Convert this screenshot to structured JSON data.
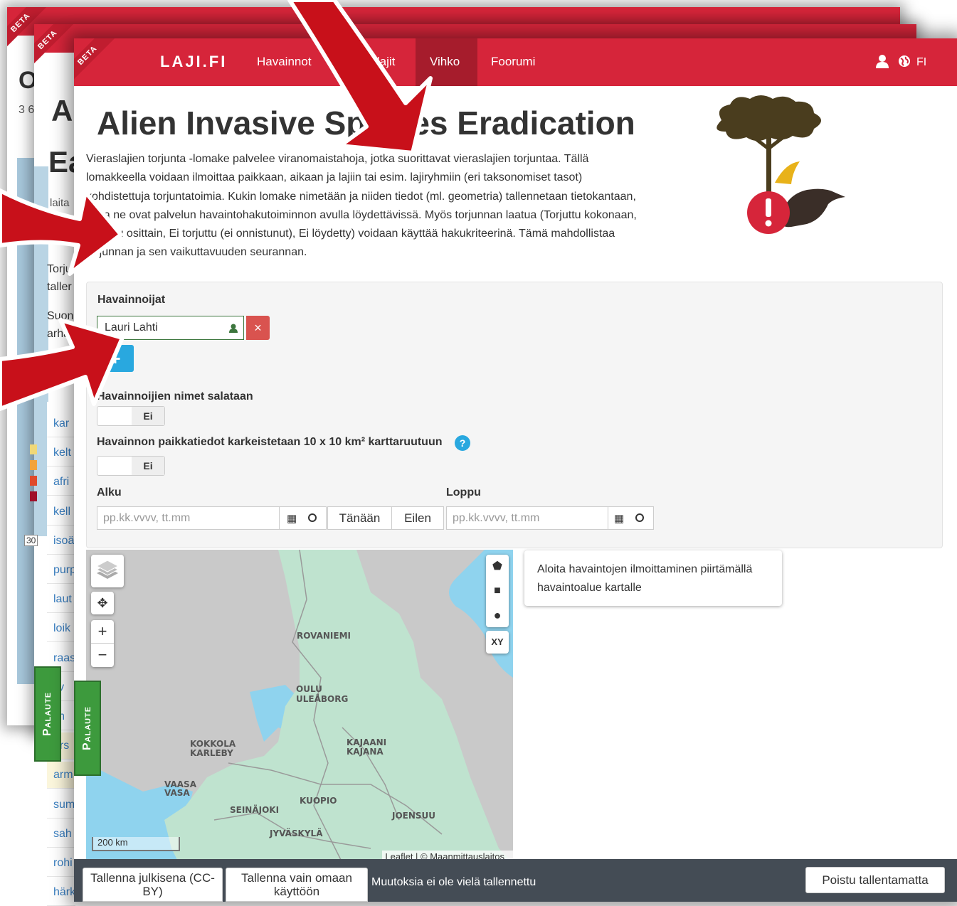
{
  "back_window_1": {
    "title_fragment": "O",
    "subtitle_fragment": "3 6",
    "text_fragment": "laita"
  },
  "back_window_2": {
    "title_fragment_1": "A",
    "title_fragment_2": "Ea",
    "text_fragments": [
      "Torju",
      "taller",
      "Suon",
      "arha"
    ],
    "species_list": [
      "kar",
      "kelt",
      "afri",
      "kell",
      "isoä",
      "purp",
      "laut",
      "loik",
      "raas",
      "ilv",
      "lin",
      "ers",
      "arm",
      "sum",
      "sah",
      "rohi",
      "härk"
    ],
    "scale_fragment": "30",
    "palaute_label": "Palaute"
  },
  "navbar": {
    "beta_label": "BETA",
    "brand": "LAJI.FI",
    "items": [
      "Havainnot",
      "Vieraslajit",
      "Vihko",
      "Foorumi"
    ],
    "active_item": "Vihko",
    "language": "FI",
    "color": "#d6253a",
    "active_color": "#a61c2c"
  },
  "page": {
    "title": "Alien Invasive Species Eradication",
    "description": "Vieraslajien torjunta -lomake palvelee viranomaistahoja, jotka suorittavat vieraslajien torjuntaa. Tällä lomakkeella voidaan ilmoittaa paikkaan, aikaan ja lajiin tai esim. lajiryhmiin (eri taksonomiset tasot) kohdistettuja torjuntatoimia. Kukin lomake nimetään ja niiden tiedot (ml. geometria) tallennetaan tietokantaan, josta ne ovat palvelun havaintohakutoiminnon avulla löydettävissä. Myös torjunnan laatua (Torjuttu kokonaan, Torjuttu osittain, Ei torjuttu (ei onnistunut), Ei löydetty) voidaan käyttää hakukriteerinä. Tämä mahdollistaa torjunnan ja sen vaikuttavuuden seurannan."
  },
  "form": {
    "observers_label": "Havainnoijat",
    "observer_value": "Lauri Lahti",
    "add_observer_label": "+",
    "hide_names_label": "Havainnoijien nimet salataan",
    "hide_names_value": "Ei",
    "coarse_location_label": "Havainnon paikkatiedot karkeistetaan 10 x 10 km² karttaruutuun",
    "help_label": "?",
    "coarse_location_value": "Ei",
    "start_label": "Alku",
    "end_label": "Loppu",
    "date_placeholder": "pp.kk.vvvv, tt.mm",
    "today_label": "Tänään",
    "yesterday_label": "Eilen"
  },
  "map": {
    "tooltip": "Aloita havaintojen ilmoittaminen piirtämällä havaintoalue kartalle",
    "xy_label": "XY",
    "zoom_in": "+",
    "zoom_out": "−",
    "scale_label": "200 km",
    "attribution": "Leaflet | © Maanmittauslaitos",
    "cities": [
      "ROVANIEMI",
      "OULU",
      "ULEÅBORG",
      "KOKKOLA",
      "KARLEBY",
      "KAJAANI",
      "KAJANA",
      "VAASA",
      "VASA",
      "SEINÄJOKI",
      "KUOPIO",
      "JOENSUU",
      "JYVÄSKYLÄ"
    ]
  },
  "footer": {
    "save_public": "Tallenna julkisena (CC-BY)",
    "save_private": "Tallenna vain omaan käyttöön",
    "status": "Muutoksia ei ole vielä tallennettu",
    "exit": "Poistu tallentamatta"
  },
  "palaute_label": "Palaute",
  "colors": {
    "brand_red": "#d6253a",
    "info_blue": "#29a8df",
    "danger_red": "#d9534f",
    "footer_bg": "#444c55",
    "palaute_green": "#3d9a3d",
    "arrow_red": "#c8101a"
  }
}
